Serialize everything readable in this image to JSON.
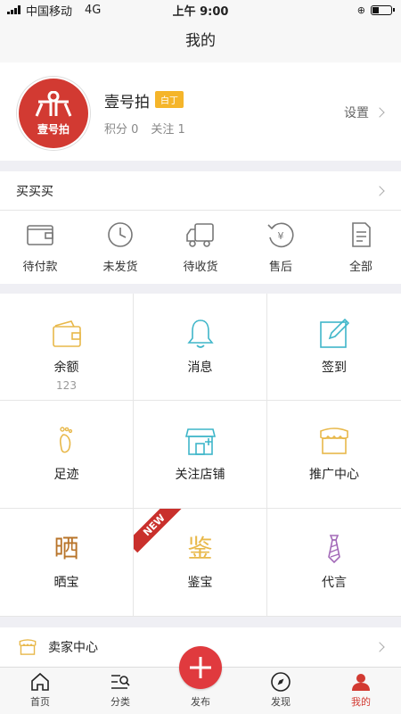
{
  "status": {
    "carrier": "中国移动",
    "network": "4G",
    "time": "上午 9:00"
  },
  "nav": {
    "title": "我的"
  },
  "profile": {
    "avatar_text": "壹号拍",
    "username": "壹号拍",
    "badge": "白丁",
    "points_label": "积分 0",
    "follow_label": "关注 1",
    "settings_label": "设置"
  },
  "buy": {
    "title": "买买买",
    "orders": [
      {
        "label": "待付款",
        "icon": "wallet-icon"
      },
      {
        "label": "未发货",
        "icon": "clock-icon"
      },
      {
        "label": "待收货",
        "icon": "truck-icon"
      },
      {
        "label": "售后",
        "icon": "refund-icon"
      },
      {
        "label": "全部",
        "icon": "document-icon"
      }
    ]
  },
  "grid": [
    {
      "label": "余额",
      "sub": "123",
      "icon": "wallet-icon",
      "color": "#e8b84a"
    },
    {
      "label": "消息",
      "icon": "bell-icon",
      "color": "#3fb6c9"
    },
    {
      "label": "签到",
      "icon": "edit-icon",
      "color": "#3fb6c9"
    },
    {
      "label": "足迹",
      "icon": "footprint-icon",
      "color": "#e8b84a"
    },
    {
      "label": "关注店铺",
      "icon": "store-icon",
      "color": "#3fb6c9"
    },
    {
      "label": "推广中心",
      "icon": "shop-icon",
      "color": "#e8b84a"
    },
    {
      "label": "晒宝",
      "glyph": "晒",
      "icon": "show-icon",
      "color": "#b8742a"
    },
    {
      "label": "鉴宝",
      "glyph": "鉴",
      "icon": "appraise-icon",
      "color": "#e8b84a",
      "ribbon": "NEW"
    },
    {
      "label": "代言",
      "icon": "tie-icon",
      "color": "#a36ab8"
    }
  ],
  "seller": {
    "label": "卖家中心"
  },
  "tabs": [
    {
      "label": "首页",
      "icon": "home-icon"
    },
    {
      "label": "分类",
      "icon": "category-icon"
    },
    {
      "label": "发布",
      "icon": "plus-icon"
    },
    {
      "label": "发现",
      "icon": "compass-icon"
    },
    {
      "label": "我的",
      "icon": "user-icon",
      "active": true
    }
  ],
  "colors": {
    "accent": "#d23a32",
    "badge": "#f5b52a",
    "teal": "#3fb6c9",
    "gold": "#e8b84a"
  }
}
